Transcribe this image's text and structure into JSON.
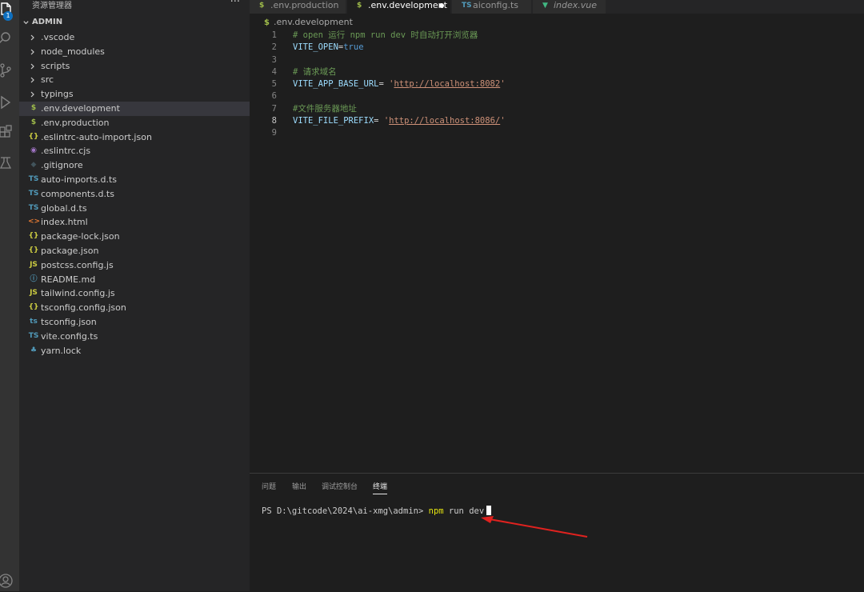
{
  "sidebar": {
    "title": "资源管理器",
    "more": "···",
    "section": "ADMIN",
    "items": [
      {
        "name": ".vscode",
        "type": "folder"
      },
      {
        "name": "node_modules",
        "type": "folder"
      },
      {
        "name": "scripts",
        "type": "folder"
      },
      {
        "name": "src",
        "type": "folder"
      },
      {
        "name": "typings",
        "type": "folder"
      },
      {
        "name": ".env.development",
        "type": "env",
        "icon": "$",
        "color": "#9fbc4a",
        "selected": true
      },
      {
        "name": ".env.production",
        "type": "env",
        "icon": "$",
        "color": "#9fbc4a"
      },
      {
        "name": ".eslintrc-auto-import.json",
        "type": "json",
        "icon": "{}",
        "color": "#cbcb41"
      },
      {
        "name": ".eslintrc.cjs",
        "type": "eslint",
        "icon": "◉",
        "color": "#a074c4"
      },
      {
        "name": ".gitignore",
        "type": "git",
        "icon": "◆",
        "color": "#41535b"
      },
      {
        "name": "auto-imports.d.ts",
        "type": "ts",
        "icon": "TS",
        "color": "#519aba"
      },
      {
        "name": "components.d.ts",
        "type": "ts",
        "icon": "TS",
        "color": "#519aba"
      },
      {
        "name": "global.d.ts",
        "type": "ts",
        "icon": "TS",
        "color": "#519aba"
      },
      {
        "name": "index.html",
        "type": "html",
        "icon": "<>",
        "color": "#e37933"
      },
      {
        "name": "package-lock.json",
        "type": "json",
        "icon": "{}",
        "color": "#cbcb41"
      },
      {
        "name": "package.json",
        "type": "json",
        "icon": "{}",
        "color": "#cbcb41"
      },
      {
        "name": "postcss.config.js",
        "type": "js",
        "icon": "JS",
        "color": "#cbcb41"
      },
      {
        "name": "README.md",
        "type": "md",
        "icon": "ⓘ",
        "color": "#519aba"
      },
      {
        "name": "tailwind.config.js",
        "type": "js",
        "icon": "JS",
        "color": "#cbcb41"
      },
      {
        "name": "tsconfig.config.json",
        "type": "json",
        "icon": "{}",
        "color": "#cbcb41"
      },
      {
        "name": "tsconfig.json",
        "type": "tsconfig",
        "icon": "ts",
        "color": "#519aba"
      },
      {
        "name": "vite.config.ts",
        "type": "ts",
        "icon": "TS",
        "color": "#519aba"
      },
      {
        "name": "yarn.lock",
        "type": "yarn",
        "icon": "♣",
        "color": "#519aba"
      }
    ]
  },
  "activity": {
    "badge": "1"
  },
  "tabs": [
    {
      "name": ".env.production",
      "icon": "$",
      "color": "#9fbc4a"
    },
    {
      "name": ".env.development",
      "icon": "$",
      "color": "#9fbc4a",
      "active": true,
      "dirty": true
    },
    {
      "name": "aiconfig.ts",
      "icon": "TS",
      "color": "#519aba"
    },
    {
      "name": "index.vue",
      "icon": "▼",
      "color": "#41b883",
      "italic": true
    }
  ],
  "breadcrumb": {
    "icon": "$",
    "file": ".env.development"
  },
  "code_lines": [
    {
      "n": "1",
      "comment": "# open 运行 npm run dev 时自动打开浏览器"
    },
    {
      "n": "2",
      "key": "VITE_OPEN",
      "op": "=",
      "value": "true"
    },
    {
      "n": "3"
    },
    {
      "n": "4",
      "comment": "# 请求域名"
    },
    {
      "n": "5",
      "key": "VITE_APP_BASE_URL",
      "op": "= ",
      "q": "'",
      "url": "http://localhost:8082",
      "q2": "'"
    },
    {
      "n": "6"
    },
    {
      "n": "7",
      "comment": "#文件服务器地址"
    },
    {
      "n": "8",
      "key": "VITE_FILE_PREFIX",
      "op": "= ",
      "q": "'",
      "url": "http://localhost:8086/",
      "q2": "'",
      "active": true
    },
    {
      "n": "9"
    }
  ],
  "panel": {
    "tabs": [
      "问题",
      "输出",
      "调试控制台",
      "终端"
    ],
    "active_tab": "终端",
    "prompt": "PS D:\\gitcode\\2024\\ai-xmg\\admin> ",
    "command": "npm",
    "args": " run dev"
  },
  "colors": {
    "accent": "#0e70c0",
    "arrow": "#e0221f"
  }
}
